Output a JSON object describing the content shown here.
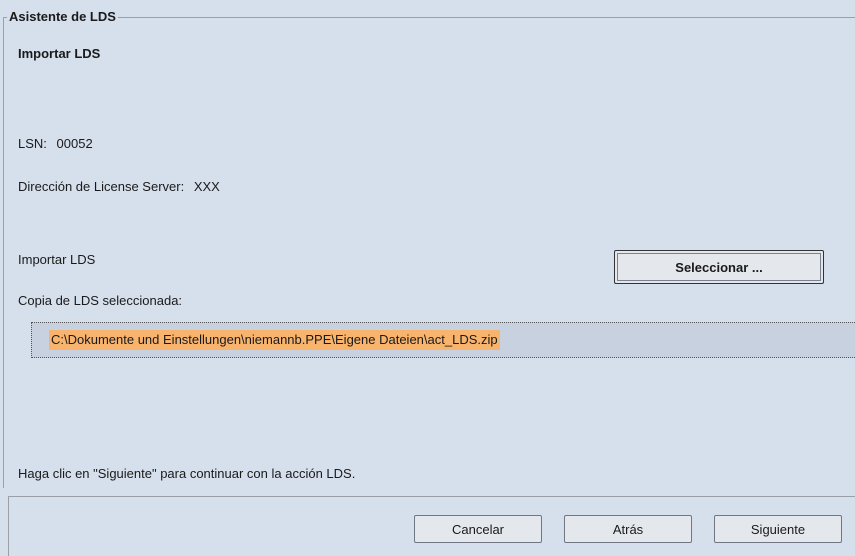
{
  "wizard": {
    "legend": "Asistente de LDS",
    "title": "Importar LDS"
  },
  "info": {
    "lsn_label": "LSN:",
    "lsn_value": "00052",
    "server_label": "Dirección de License Server:",
    "server_value": "XXX"
  },
  "import": {
    "label": "Importar LDS",
    "select_button": "Seleccionar ...",
    "copy_label": "Copia de LDS seleccionada:",
    "selected_file": "C:\\Dokumente und Einstellungen\\niemannb.PPE\\Eigene Dateien\\act_LDS.zip"
  },
  "instruction": "Haga clic en \"Siguiente\" para continuar con la acción LDS.",
  "footer": {
    "cancel": "Cancelar",
    "back": "Atrás",
    "next": "Siguiente"
  },
  "colors": {
    "background": "#d6dfec",
    "selection_highlight": "#f8b36c",
    "button_face": "#e4e7ec"
  }
}
